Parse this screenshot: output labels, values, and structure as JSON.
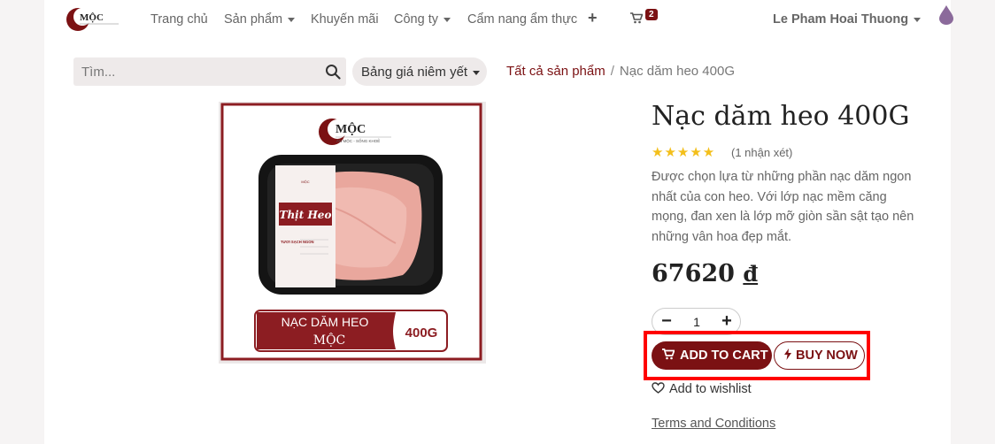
{
  "nav": {
    "logo_text": "MỘC",
    "items": [
      {
        "label": "Trang chủ",
        "has_dropdown": false
      },
      {
        "label": "Sản phẩm",
        "has_dropdown": true
      },
      {
        "label": "Khuyến mãi",
        "has_dropdown": false
      },
      {
        "label": "Công ty",
        "has_dropdown": true
      },
      {
        "label": "Cẩm nang ẩm thực",
        "has_dropdown": false
      }
    ],
    "plus_icon": "+",
    "cart_count": "2",
    "user_name": "Le Pham Hoai Thuong"
  },
  "search": {
    "placeholder": "Tìm..."
  },
  "pricelist": {
    "label": "Bảng giá niêm yết"
  },
  "breadcrumb": {
    "link": "Tất cả sản phẩm",
    "separator": "/",
    "current": "Nạc dăm heo 400G"
  },
  "product_image": {
    "brand": "MỘC",
    "tagline": "ĂN MỘC - SỐNG KHOẺ",
    "pack_label": "Thịt Heo",
    "pack_badge": "TƯƠI SẠCH NGON",
    "banner_line1": "NẠC DĂM HEO",
    "banner_line2": "MỘC",
    "banner_weight": "400G"
  },
  "product": {
    "title": "Nạc dăm heo 400G",
    "stars": "★★★★★",
    "rating": 5,
    "review_text": "(1 nhận xét)",
    "description": "Được chọn lựa từ những phần nạc dăm ngon nhất của con heo. Với lớp nạc mềm căng mọng, đan xen là lớp mỡ giòn sần sật tạo nên những vân hoa đẹp mắt.",
    "price": "67620",
    "currency": "đ",
    "quantity": "1",
    "qty_minus": "−",
    "qty_plus": "+",
    "add_to_cart": "ADD TO CART",
    "buy_now": "BUY NOW",
    "wishlist": "Add to wishlist",
    "terms": "Terms and Conditions"
  },
  "colors": {
    "brand": "#7b1113",
    "highlight": "#ff0000",
    "star": "#f3bf1b",
    "drop": "#8b6a9b"
  }
}
